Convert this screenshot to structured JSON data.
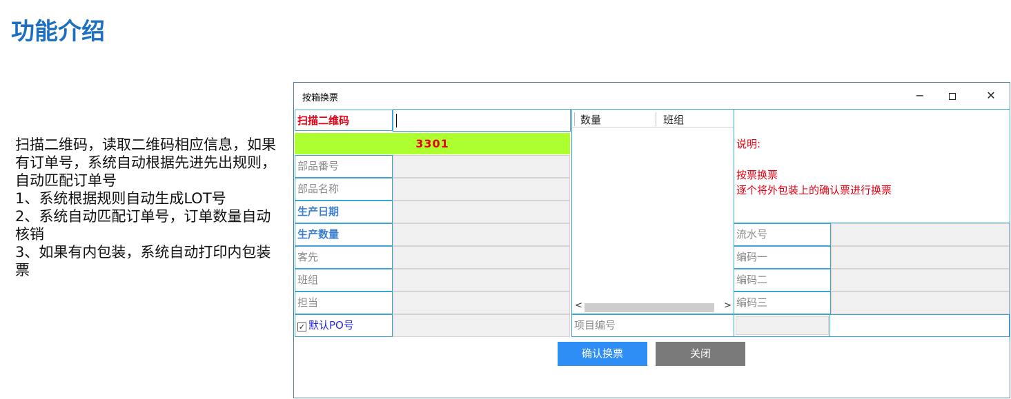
{
  "page": {
    "title": "功能介绍",
    "description_lines": [
      "扫描二维码，读取二维码相应信息，如果有订单号，系统自动根据先进先出规则，自动匹配订单号",
      "1、系统根据规则自动生成LOT号",
      "2、系统自动匹配订单号，订单数量自动核销",
      "3、如果有内包装，系统自动打印内包装票"
    ]
  },
  "window": {
    "title": "按箱换票",
    "minimize_label": "−",
    "close_label": "✕"
  },
  "form": {
    "scan_label": "扫描二维码",
    "scan_value": "",
    "code_value": "3301",
    "part_no_label": "部品番号",
    "part_name_label": "部品名称",
    "production_date_label": "生产日期",
    "production_qty_label": "生产数量",
    "customer_label": "客先",
    "team_label": "班组",
    "person_label": "担当",
    "default_po_label": "默认PO号",
    "default_po_checked": true,
    "project_no_label": "项目编号"
  },
  "listview": {
    "columns": [
      "数量",
      "班组"
    ],
    "scroll_left": "<",
    "scroll_right": ">"
  },
  "notes": {
    "heading": "说明:",
    "line1": "按票换票",
    "line2": "逐个将外包装上的确认票进行换票"
  },
  "right_form": {
    "serial_label": "流水号",
    "code1_label": "编码一",
    "code2_label": "编码二",
    "code3_label": "编码三"
  },
  "buttons": {
    "confirm": "确认换票",
    "close": "关闭"
  },
  "colors": {
    "accent_blue": "#1e6fc0",
    "highlight_green": "#adff2f",
    "alert_red": "#e60012",
    "border_cyan": "#3aa6d6"
  }
}
